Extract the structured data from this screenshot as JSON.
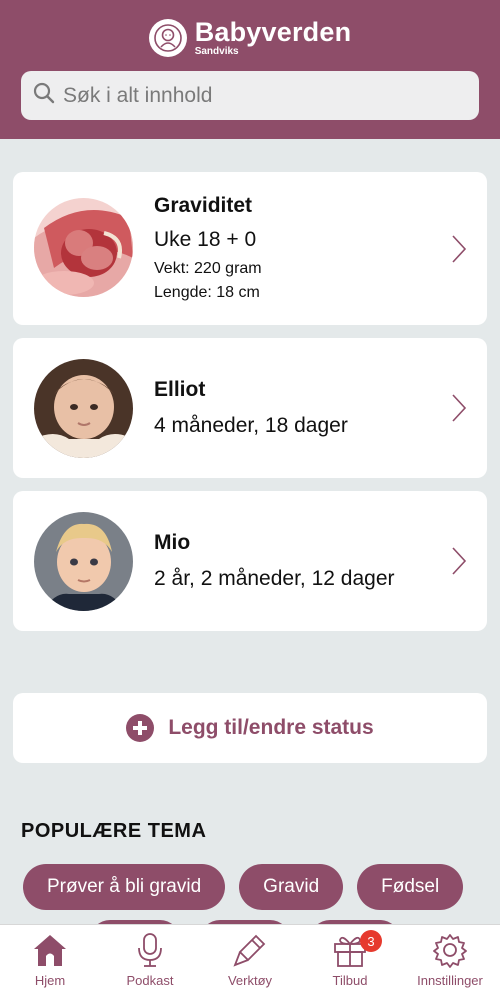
{
  "header": {
    "brand_name": "Babyverden",
    "brand_sub": "Sandviks"
  },
  "search": {
    "placeholder": "Søk i alt innhold"
  },
  "cards": {
    "pregnancy": {
      "title": "Graviditet",
      "week": "Uke 18 + 0",
      "weight": "Vekt: 220 gram",
      "length": "Lengde: 18 cm"
    },
    "elliot": {
      "name": "Elliot",
      "age": "4 måneder, 18 dager"
    },
    "mio": {
      "name": "Mio",
      "age": "2 år, 2 måneder, 12 dager"
    }
  },
  "status_button": {
    "label": "Legg til/endre status"
  },
  "popular": {
    "title": "POPULÆRE TEMA",
    "chips": [
      "Prøver å bli gravid",
      "Gravid",
      "Fødsel"
    ]
  },
  "tabbar": {
    "items": [
      {
        "label": "Hjem",
        "icon": "home-icon"
      },
      {
        "label": "Podkast",
        "icon": "microphone-icon"
      },
      {
        "label": "Verktøy",
        "icon": "brush-icon"
      },
      {
        "label": "Tilbud",
        "icon": "gift-icon",
        "badge": "3"
      },
      {
        "label": "Innstillinger",
        "icon": "gear-icon"
      }
    ]
  },
  "colors": {
    "brand": "#8e4d69",
    "background": "#e4e9ea",
    "badge": "#e63a2e"
  }
}
